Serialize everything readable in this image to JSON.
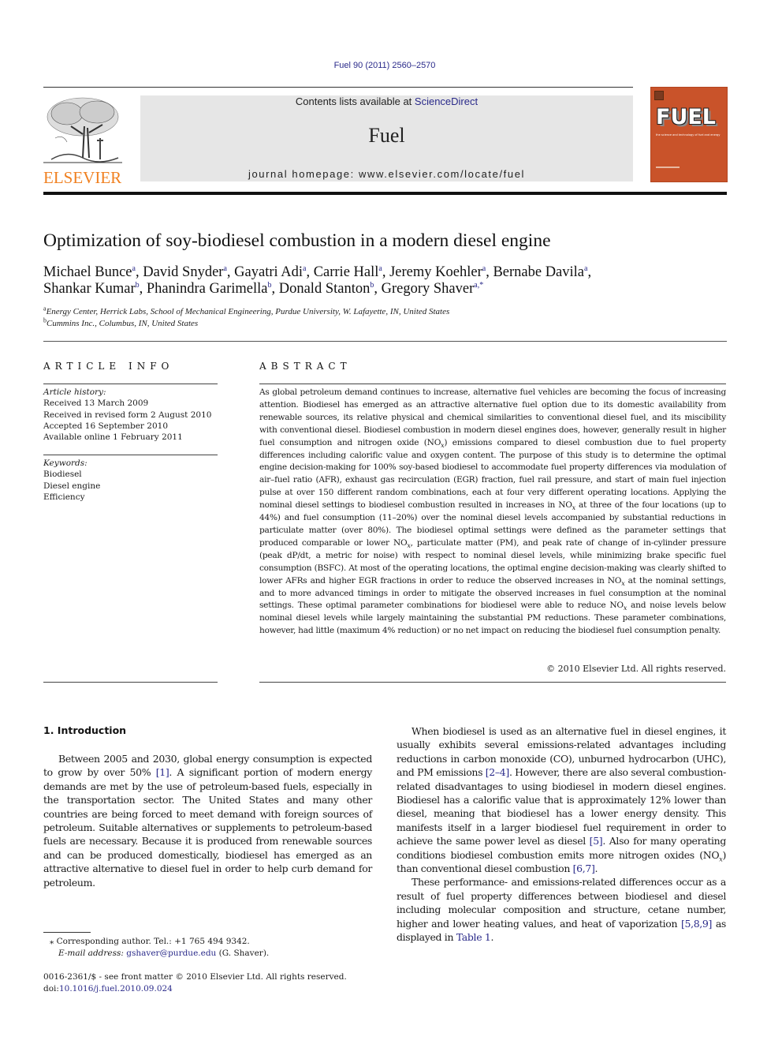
{
  "header": {
    "journal_ref": "Fuel 90 (2011) 2560–2570",
    "contents_prefix": "Contents lists available at ",
    "contents_link": "ScienceDirect",
    "journal_name": "Fuel",
    "homepage": "journal homepage: www.elsevier.com/locate/fuel",
    "publisher_wordmark": "ELSEVIER",
    "cover_title": "FUEL",
    "cover_subtitle": "the science and technology of fuel and energy",
    "link_color": "#2a2a8a",
    "publisher_color": "#f08020",
    "cover_color": "#c9532a"
  },
  "article": {
    "title": "Optimization of soy-biodiesel combustion in a modern diesel engine",
    "authors": [
      {
        "name": "Michael Bunce",
        "aff": "a",
        "sep": ", "
      },
      {
        "name": "David Snyder",
        "aff": "a",
        "sep": ", "
      },
      {
        "name": "Gayatri Adi",
        "aff": "a",
        "sep": ", "
      },
      {
        "name": "Carrie Hall",
        "aff": "a",
        "sep": ", "
      },
      {
        "name": "Jeremy Koehler",
        "aff": "a",
        "sep": ", "
      },
      {
        "name": "Bernabe Davila",
        "aff": "a",
        "sep": ","
      },
      {
        "name": "Shankar Kumar",
        "aff": "b",
        "sep": ", "
      },
      {
        "name": "Phanindra Garimella",
        "aff": "b",
        "sep": ", "
      },
      {
        "name": "Donald Stanton",
        "aff": "b",
        "sep": ", "
      },
      {
        "name": "Gregory Shaver",
        "aff": "a,*",
        "sep": ""
      }
    ],
    "affiliations": [
      {
        "key": "a",
        "text": "Energy Center, Herrick Labs, School of Mechanical Engineering, Purdue University, W. Lafayette, IN, United States"
      },
      {
        "key": "b",
        "text": "Cummins Inc., Columbus, IN, United States"
      }
    ]
  },
  "article_info": {
    "heading": "ARTICLE INFO",
    "history_label": "Article history:",
    "history": [
      "Received 13 March 2009",
      "Received in revised form 2 August 2010",
      "Accepted 16 September 2010",
      "Available online 1 February 2011"
    ],
    "keywords_label": "Keywords:",
    "keywords": [
      "Biodiesel",
      "Diesel engine",
      "Efficiency"
    ]
  },
  "abstract": {
    "heading": "ABSTRACT",
    "parts": {
      "p1": "As global petroleum demand continues to increase, alternative fuel vehicles are becoming the focus of increasing attention. Biodiesel has emerged as an attractive alternative fuel option due to its domestic availability from renewable sources, its relative physical and chemical similarities to conventional diesel fuel, and its miscibility with conventional diesel. Biodiesel combustion in modern diesel engines does, however, generally result in higher fuel consumption and nitrogen oxide (NO",
      "p2": ") emissions compared to diesel combustion due to fuel property differences including calorific value and oxygen content. The purpose of this study is to determine the optimal engine decision-making for 100% soy-based biodiesel to accommodate fuel property differences via modulation of air–fuel ratio (AFR), exhaust gas recirculation (EGR) fraction, fuel rail pressure, and start of main fuel injection pulse at over 150 different random combinations, each at four very different operating locations. Applying the nominal diesel settings to biodiesel combustion resulted in increases in NO",
      "p3": " at three of the four locations (up to 44%) and fuel consumption (11–20%) over the nominal diesel levels accompanied by substantial reductions in particulate matter (over 80%). The biodiesel optimal settings were defined as the parameter settings that produced comparable or lower NO",
      "p4": ", particulate matter (PM), and peak rate of change of in-cylinder pressure (peak dP/dt, a metric for noise) with respect to nominal diesel levels, while minimizing brake specific fuel consumption (BSFC). At most of the operating locations, the optimal engine decision-making was clearly shifted to lower AFRs and higher EGR fractions in order to reduce the observed increases in NO",
      "p5": " at the nominal settings, and to more advanced timings in order to mitigate the observed increases in fuel consumption at the nominal settings. These optimal parameter combinations for biodiesel were able to reduce NO",
      "p6": " and noise levels below nominal diesel levels while largely maintaining the substantial PM reductions. These parameter combinations, however, had little (maximum 4% reduction) or no net impact on reducing the biodiesel fuel consumption penalty."
    },
    "subscript_x": "x",
    "copyright": "© 2010 Elsevier Ltd. All rights reserved."
  },
  "introduction": {
    "heading": "1. Introduction",
    "left": {
      "a": "Between 2005 and 2030, global energy consumption is expected to grow by over 50% ",
      "ref1": "[1]",
      "b": ". A significant portion of modern energy demands are met by the use of petroleum-based fuels, especially in the transportation sector. The United States and many other countries are being forced to meet demand with foreign sources of petroleum. Suitable alternatives or supplements to petroleum-based fuels are necessary. Because it is produced from renewable sources and can be produced domestically, biodiesel has emerged as an attractive alternative to diesel fuel in order to help curb demand for petroleum."
    },
    "right_p1": {
      "a": "When biodiesel is used as an alternative fuel in diesel engines, it usually exhibits several emissions-related advantages including reductions in carbon monoxide (CO), unburned hydrocarbon (UHC), and PM emissions ",
      "ref1": "[2–4]",
      "b": ". However, there are also several combustion-related disadvantages to using biodiesel in modern diesel engines. Biodiesel has a calorific value that is approximately 12% lower than diesel, meaning that biodiesel has a lower energy density. This manifests itself in a larger biodiesel fuel requirement in order to achieve the same power level as diesel ",
      "ref2": "[5]",
      "c": ". Also for many operating conditions biodiesel combustion emits more nitrogen oxides (NO",
      "d": ") than conventional diesel combustion ",
      "ref3": "[6,7]",
      "e": "."
    },
    "right_p2": {
      "a": "These performance- and emissions-related differences occur as a result of fuel property differences between biodiesel and diesel including molecular composition and structure, cetane number, higher and lower heating values, and heat of vaporization ",
      "ref1": "[5,8,9]",
      "b": " as displayed in ",
      "ref2": "Table 1",
      "c": "."
    }
  },
  "footnote": {
    "marker": "⁎",
    "line1": "Corresponding author. Tel.: +1 765 494 9342.",
    "email_label": "E-mail address:",
    "email": "gshaver@purdue.edu",
    "email_suffix": " (G. Shaver)."
  },
  "front_matter": {
    "line1": "0016-2361/$ - see front matter © 2010 Elsevier Ltd. All rights reserved.",
    "doi_label": "doi:",
    "doi": "10.1016/j.fuel.2010.09.024"
  }
}
